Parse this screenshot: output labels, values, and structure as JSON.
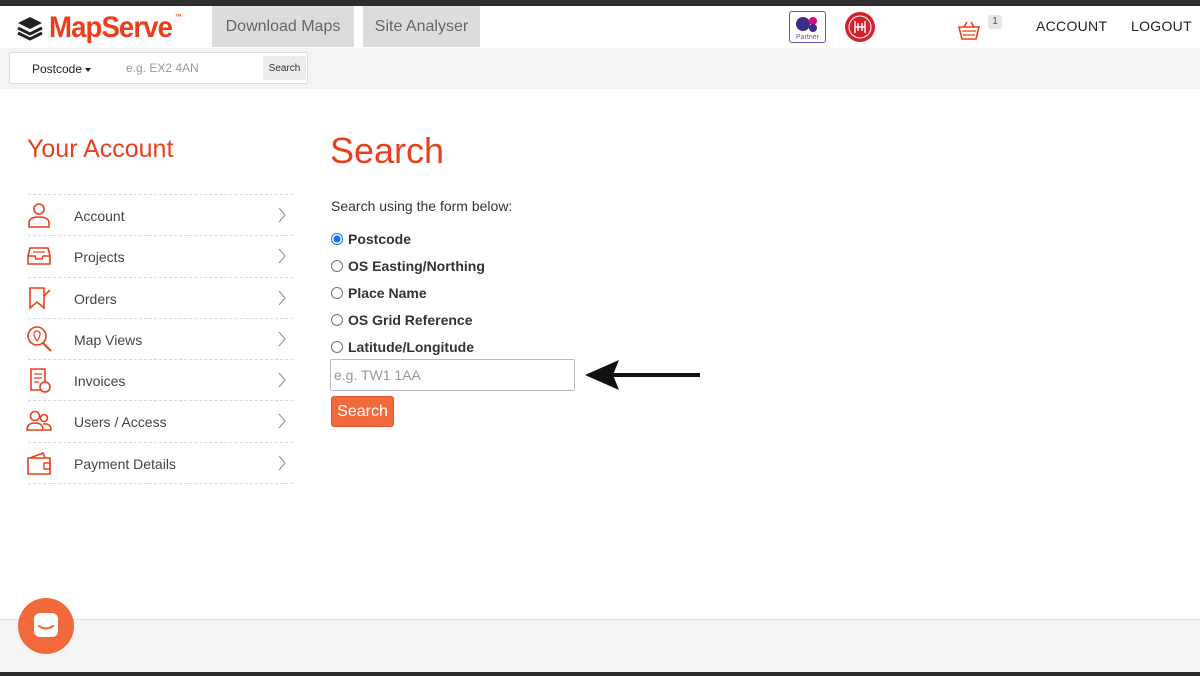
{
  "brand": {
    "name": "MapServe",
    "tm": "™"
  },
  "nav": {
    "tabs": [
      "Download Maps",
      "Site Analyser"
    ]
  },
  "partner": {
    "os_label": "Partner"
  },
  "basket": {
    "count": "1"
  },
  "header_links": {
    "account": "ACCOUNT",
    "logout": "LOGOUT"
  },
  "quick_search": {
    "type_label": "Postcode",
    "placeholder": "e.g. EX2 4AN",
    "button": "Search"
  },
  "sidebar": {
    "title": "Your Account",
    "items": [
      {
        "label": "Account",
        "icon": "user-icon"
      },
      {
        "label": "Projects",
        "icon": "inbox-icon"
      },
      {
        "label": "Orders",
        "icon": "bookmark-icon"
      },
      {
        "label": "Map Views",
        "icon": "map-search-icon"
      },
      {
        "label": "Invoices",
        "icon": "invoice-icon"
      },
      {
        "label": "Users / Access",
        "icon": "users-icon"
      },
      {
        "label": "Payment Details",
        "icon": "wallet-icon"
      }
    ]
  },
  "main": {
    "title": "Search",
    "description": "Search using the form below:",
    "options": [
      "Postcode",
      "OS Easting/Northing",
      "Place Name",
      "OS Grid Reference",
      "Latitude/Longitude"
    ],
    "selected": "Postcode",
    "input_placeholder": "e.g. TW1 1AA",
    "button": "Search"
  },
  "colors": {
    "accent": "#e8401c",
    "button": "#f26a3b",
    "partner_purple": "#6b4fa8"
  }
}
